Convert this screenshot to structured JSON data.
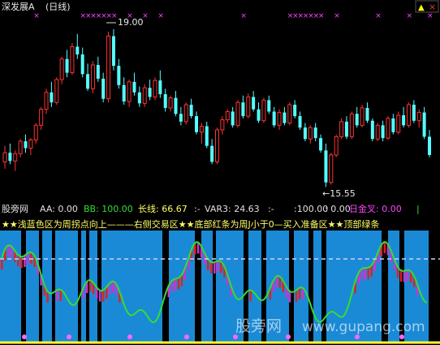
{
  "header": {
    "title": "深发展A",
    "period": "(日线)",
    "window_buttons": [
      "▲",
      "×"
    ]
  },
  "top_chart": {
    "high_label": "19.00",
    "low_label": "←15.55",
    "colors": {
      "up": "#ff3232",
      "down": "#54ffff",
      "marker": "#ff44ff"
    },
    "candles": [
      [
        16.1,
        16.45,
        15.95,
        16.3
      ],
      [
        16.3,
        16.5,
        16.05,
        16.12
      ],
      [
        16.12,
        16.35,
        15.9,
        16.28
      ],
      [
        16.28,
        16.6,
        16.2,
        16.55
      ],
      [
        16.55,
        16.7,
        16.3,
        16.4
      ],
      [
        16.4,
        16.62,
        16.25,
        16.58
      ],
      [
        16.58,
        16.95,
        16.5,
        16.9
      ],
      [
        16.9,
        17.3,
        16.8,
        17.25
      ],
      [
        17.25,
        17.7,
        17.15,
        17.62
      ],
      [
        17.62,
        17.85,
        17.3,
        17.4
      ],
      [
        17.4,
        17.95,
        17.35,
        17.9
      ],
      [
        17.9,
        18.4,
        17.8,
        18.35
      ],
      [
        18.35,
        18.55,
        17.95,
        18.05
      ],
      [
        18.05,
        18.7,
        18.0,
        18.62
      ],
      [
        18.62,
        18.9,
        18.35,
        18.45
      ],
      [
        18.45,
        18.6,
        17.95,
        18.02
      ],
      [
        18.02,
        18.25,
        17.65,
        17.7
      ],
      [
        17.7,
        18.3,
        17.6,
        18.22
      ],
      [
        18.22,
        18.4,
        17.85,
        17.92
      ],
      [
        17.92,
        18.05,
        17.4,
        17.48
      ],
      [
        17.48,
        18.95,
        17.4,
        18.85
      ],
      [
        18.85,
        19.0,
        18.1,
        18.2
      ],
      [
        18.2,
        18.35,
        17.7,
        17.78
      ],
      [
        17.78,
        17.95,
        17.35,
        17.42
      ],
      [
        17.42,
        17.9,
        17.3,
        17.85
      ],
      [
        17.85,
        18.05,
        17.55,
        17.62
      ],
      [
        17.62,
        17.75,
        17.3,
        17.38
      ],
      [
        17.38,
        17.8,
        17.3,
        17.72
      ],
      [
        17.72,
        17.9,
        17.45,
        17.52
      ],
      [
        17.52,
        17.95,
        17.45,
        17.88
      ],
      [
        17.88,
        18.1,
        17.5,
        17.58
      ],
      [
        17.58,
        17.7,
        17.2,
        17.28
      ],
      [
        17.28,
        17.55,
        17.2,
        17.5
      ],
      [
        17.5,
        17.65,
        17.1,
        17.15
      ],
      [
        17.15,
        17.3,
        16.9,
        16.98
      ],
      [
        16.98,
        17.4,
        16.92,
        17.35
      ],
      [
        17.35,
        17.48,
        17.05,
        17.1
      ],
      [
        17.1,
        17.2,
        16.7,
        16.75
      ],
      [
        16.75,
        16.95,
        16.5,
        16.88
      ],
      [
        16.88,
        16.98,
        16.4,
        16.45
      ],
      [
        16.45,
        16.6,
        16.05,
        16.1
      ],
      [
        16.1,
        16.85,
        16.05,
        16.8
      ],
      [
        16.8,
        17.1,
        16.7,
        17.02
      ],
      [
        17.02,
        17.25,
        16.95,
        17.2
      ],
      [
        17.2,
        17.3,
        16.85,
        16.9
      ],
      [
        16.9,
        17.45,
        16.85,
        17.4
      ],
      [
        17.4,
        17.55,
        17.05,
        17.1
      ],
      [
        17.1,
        17.6,
        17.05,
        17.52
      ],
      [
        17.52,
        17.65,
        17.2,
        17.25
      ],
      [
        17.25,
        17.4,
        16.95,
        17.0
      ],
      [
        17.0,
        17.5,
        16.95,
        17.45
      ],
      [
        17.45,
        17.55,
        17.15,
        17.2
      ],
      [
        17.2,
        17.3,
        16.85,
        16.9
      ],
      [
        16.9,
        17.25,
        16.8,
        17.18
      ],
      [
        17.18,
        17.3,
        16.9,
        16.95
      ],
      [
        16.95,
        17.4,
        16.9,
        17.35
      ],
      [
        17.35,
        17.45,
        17.05,
        17.1
      ],
      [
        17.1,
        17.2,
        16.8,
        16.85
      ],
      [
        16.85,
        16.95,
        16.55,
        16.6
      ],
      [
        16.6,
        16.9,
        16.5,
        16.85
      ],
      [
        16.85,
        16.95,
        16.55,
        16.62
      ],
      [
        16.62,
        16.7,
        16.3,
        16.35
      ],
      [
        16.35,
        16.5,
        15.55,
        15.65
      ],
      [
        15.65,
        16.3,
        15.6,
        16.25
      ],
      [
        16.25,
        16.7,
        16.2,
        16.65
      ],
      [
        16.65,
        17.05,
        16.6,
        16.98
      ],
      [
        16.98,
        17.1,
        16.6,
        16.65
      ],
      [
        16.65,
        17.2,
        16.6,
        17.15
      ],
      [
        17.15,
        17.3,
        16.85,
        16.9
      ],
      [
        16.9,
        17.35,
        16.85,
        17.28
      ],
      [
        17.28,
        17.4,
        16.95,
        17.0
      ],
      [
        17.0,
        17.05,
        16.55,
        16.6
      ],
      [
        16.6,
        16.95,
        16.55,
        16.9
      ],
      [
        16.9,
        17.0,
        16.55,
        16.62
      ],
      [
        16.62,
        17.1,
        16.58,
        17.05
      ],
      [
        17.05,
        17.15,
        16.7,
        16.75
      ],
      [
        16.75,
        17.2,
        16.7,
        17.12
      ],
      [
        17.12,
        17.3,
        16.85,
        16.9
      ],
      [
        16.9,
        17.4,
        16.85,
        17.35
      ],
      [
        17.35,
        17.45,
        16.95,
        17.0
      ],
      [
        17.0,
        17.25,
        16.85,
        17.18
      ],
      [
        17.18,
        17.3,
        16.6,
        16.65
      ],
      [
        16.65,
        16.8,
        16.2,
        16.25
      ]
    ],
    "markers": [
      6,
      15,
      16,
      17,
      18,
      19,
      20,
      21,
      24,
      27,
      30,
      46,
      55,
      56,
      57,
      58,
      59,
      60,
      61,
      64,
      72,
      78,
      82
    ]
  },
  "status_bar": {
    "site": "股旁网",
    "aa": "AA: 0.00",
    "bb": "BB: 100.00",
    "changxian": "长线: 66.67",
    "sep1": ":-",
    "var3": "VAR3: 24.63",
    "sep2": ":-",
    "val1": ":100.00",
    "val2": ": 0.00",
    "rijincha": "日金叉: 0.00",
    "bar": "|"
  },
  "bottom_chart": {
    "banner": "★★浅蓝色区为周拐点向上———右侧交易区★★底部红条为周J小于0—买入准备区★★顶部绿条",
    "watermark_cn": "股旁网",
    "watermark_en": "www.gupang.com",
    "colors": {
      "blue": "#1a8ad6",
      "green": "#33dd33",
      "red": "#dd2222",
      "magenta": "#cc33cc",
      "dash": "#d0d0ff",
      "yellow": "#ffff33"
    }
  }
}
